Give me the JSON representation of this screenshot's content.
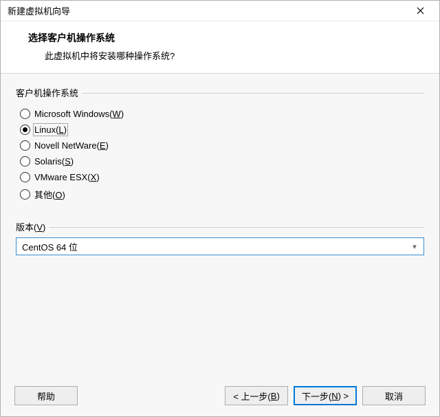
{
  "window": {
    "title": "新建虚拟机向导"
  },
  "header": {
    "title": "选择客户机操作系统",
    "subtitle": "此虚拟机中将安装哪种操作系统?"
  },
  "group_os": {
    "label": "客户机操作系统",
    "options": [
      {
        "text": "Microsoft Windows(",
        "hotkey": "W",
        "suffix": ")",
        "selected": false
      },
      {
        "text": "Linux(",
        "hotkey": "L",
        "suffix": ")",
        "selected": true
      },
      {
        "text": "Novell NetWare(",
        "hotkey": "E",
        "suffix": ")",
        "selected": false
      },
      {
        "text": "Solaris(",
        "hotkey": "S",
        "suffix": ")",
        "selected": false
      },
      {
        "text": "VMware ESX(",
        "hotkey": "X",
        "suffix": ")",
        "selected": false
      },
      {
        "text": "其他(",
        "hotkey": "O",
        "suffix": ")",
        "selected": false
      }
    ]
  },
  "version": {
    "label_prefix": "版本(",
    "label_hotkey": "V",
    "label_suffix": ")",
    "selected": "CentOS 64 位"
  },
  "buttons": {
    "help": "帮助",
    "back_prefix": "< 上一步(",
    "back_hotkey": "B",
    "back_suffix": ")",
    "next_prefix": "下一步(",
    "next_hotkey": "N",
    "next_suffix": ") >",
    "cancel": "取消"
  }
}
